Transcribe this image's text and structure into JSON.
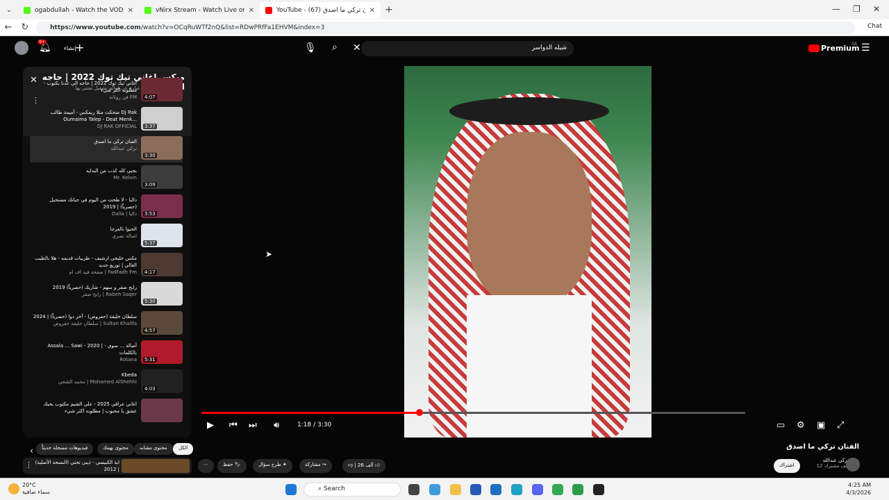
{
  "browser": {
    "tabs": [
      {
        "title": "ogabdullah - Watch the VOD on K",
        "color": "#53fc18"
      },
      {
        "title": "vNirx Stream - Watch Live on Kick",
        "color": "#53fc18"
      },
      {
        "title": "YouTube - الفنان تركي ما اصدق (67)",
        "color": "#ff0000"
      }
    ],
    "url_host": "https://www.youtube.com",
    "url_path": "/watch?v=OCqRuWTf2nQ&list=RDwPRfFa1EHVM&index=3",
    "chat_label": "Chat"
  },
  "youtube": {
    "create_label": "إنشاء",
    "notif_count": "9+",
    "search_text": "شيله الدواسر",
    "premium_label": "Premium",
    "premium_region": "SA"
  },
  "playlist": {
    "title": "ميكس اغاني تيك توك 2022 | حاجه الى",
    "subtitle": "الميكسات عبارة عن قوائم تشغيل تعتني بها YouTube.",
    "items": [
      {
        "title": "اغاني تيك توك 2022 | حاجه الي عدنا بكتوب - مطلوبه اكثر شيء",
        "channel": "فن روتانه FM",
        "duration": "4:07",
        "thumb": "#6b2a33"
      },
      {
        "title": "ضحكت مثلا ريمكس - أميمة طالب Dj Rak Oumaima Talep - Deat Menk...",
        "channel": "DJ RAK OFFICIAL",
        "duration": "3:37",
        "thumb": "#cfcfcf"
      },
      {
        "title": "الفنان تركي ما اصدق",
        "channel": "تركي عبدالله",
        "duration": "3:30",
        "thumb": "#8a6d5a"
      },
      {
        "title": "بحبي كله كذب من البدايه",
        "channel": "Mr. Kelvin",
        "duration": "3:09",
        "thumb": "#3d3d3d"
      },
      {
        "title": "داليا - لا طحت من اليوم في حياتك مستحيل (حصرياً) | 2019",
        "channel": "Dalia | داليا",
        "duration": "3:53",
        "thumb": "#7a2e4a"
      },
      {
        "title": "الحيوا بالعرجا",
        "channel": "اصالة نصري",
        "duration": "5:37",
        "thumb": "#dfe3ea"
      },
      {
        "title": "مكس خليجي ارشيف - طربيات قديمه - هلا بالطيب الغالي | توزيع جديد",
        "channel": "صفحة فيد اف ام | FadFadh Fm",
        "duration": "4:17",
        "thumb": "#4d3a32"
      },
      {
        "title": "رابح صقر و سهم - شاريك (حصرياً) 2019",
        "channel": "رابح صقر | Rabeh Saqer",
        "duration": "5:30",
        "thumb": "#d9d9d9"
      },
      {
        "title": "سلطان خليفة (حفروص) - آخر دوا (حصرياً) | 2024",
        "channel": "سلطان خليفة حفروص | Sultan Khalifa",
        "duration": "4:57",
        "thumb": "#5b4a3a"
      },
      {
        "title": "Assala ... Sawi - 2020 | أصالة ... سوي - بالكلمات",
        "channel": "Rotana",
        "duration": "5:31",
        "thumb": "#b01a2a"
      },
      {
        "title": "Kbeda",
        "channel": "محمد الشحي | Mohamed AlShehhi",
        "duration": "4:03",
        "thumb": "#222222"
      },
      {
        "title": "اغاني عراقي 2025 - علي الشيم مكتوب بحبك عشق يا محبوب | مطلوبه اكثر شيء",
        "channel": "",
        "duration": "",
        "thumb": "#6b3a4a"
      }
    ]
  },
  "player": {
    "time": "1:18 / 3:30",
    "progress": 0.4508
  },
  "below": {
    "chips": [
      "الكل",
      "محتوى مشابه",
      "محتوى يهمك",
      "فيديوهات مسجلة حديثاً"
    ],
    "next_title": "اية الكبيسي - ذيبي تحتي (النسخة الأصلية) | 2012",
    "video_title": "الفنان تركي ما اصدق",
    "channel_name": "تركي عبدالله",
    "subscribers": "12 ألف مشترك",
    "subscribe_label": "اشتراك",
    "likes": "26 ألف",
    "share_label": "مشاركة",
    "ask_label": "طرح سؤال",
    "save_label": "حفظ"
  },
  "taskbar": {
    "temp": "20°C",
    "weather": "سماء صافية",
    "search": "Search",
    "time": "4:25 AM",
    "date": "4/3/2026"
  }
}
